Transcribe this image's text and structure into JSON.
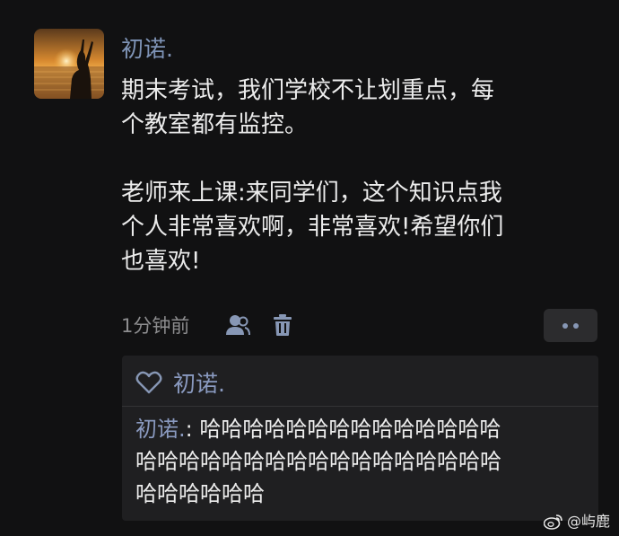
{
  "post": {
    "author": "初诺.",
    "lines_p1": [
      "期末考试，我们学校不让划重点，每",
      "个教室都有监控。"
    ],
    "lines_p2": [
      "老师来上课:来同学们，这个知识点我",
      "个人非常喜欢啊，非常喜欢!希望你们",
      "也喜欢!"
    ],
    "time": "1分钟前"
  },
  "actions": {
    "visibility_icon": "users-icon",
    "delete_icon": "trash-icon",
    "more_icon": "more-dots-icon"
  },
  "likes": {
    "icon": "heart-icon",
    "names": "初诺."
  },
  "comment": {
    "author": "初诺.",
    "separator": ": ",
    "lines": [
      "哈哈哈哈哈哈哈哈哈哈哈哈哈哈",
      "哈哈哈哈哈哈哈哈哈哈哈哈哈哈哈哈哈",
      "哈哈哈哈哈哈"
    ]
  },
  "watermark": {
    "icon": "weibo-icon",
    "text": "@屿鹿"
  },
  "colors": {
    "background": "#111112",
    "name_link": "#7f94b7",
    "text": "#ececec",
    "muted": "#8d8d8f",
    "reply_bg": "#1f1f21"
  }
}
